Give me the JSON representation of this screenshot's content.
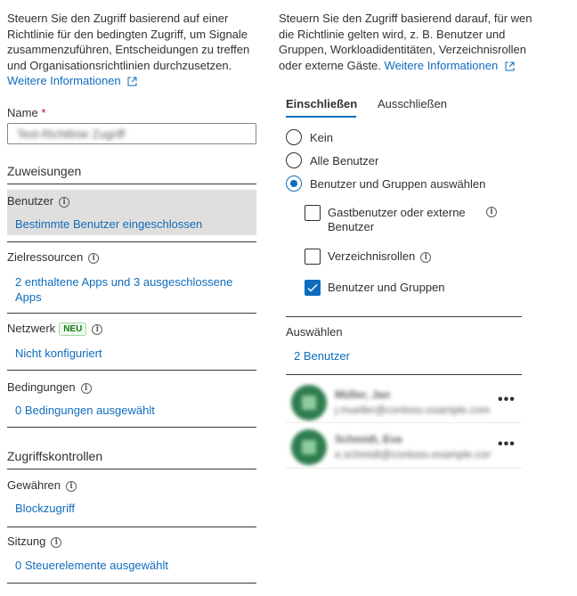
{
  "left": {
    "description": "Steuern Sie den Zugriff basierend auf einer Richtlinie für den bedingten Zugriff, um Signale zusammenzuführen, Entscheidungen zu treffen und Organisationsrichtlinien durchzusetzen.",
    "more_info": "Weitere Informationen",
    "name_label": "Name",
    "name_required": "*",
    "name_value": "Test-Richtlinie Zugriff",
    "assignments_heading": "Zuweisungen",
    "users_label": "Benutzer",
    "users_value": "Bestimmte Benutzer eingeschlossen",
    "target_label": "Zielressourcen",
    "target_value": "2 enthaltene Apps und 3 ausgeschlossene Apps",
    "network_label": "Netzwerk",
    "network_badge": "NEU",
    "network_value": "Nicht konfiguriert",
    "conditions_label": "Bedingungen",
    "conditions_value": "0 Bedingungen ausgewählt",
    "access_controls_heading": "Zugriffskontrollen",
    "grant_label": "Gewähren",
    "grant_value": "Blockzugriff",
    "session_label": "Sitzung",
    "session_value": "0 Steuerelemente ausgewählt"
  },
  "right": {
    "description": "Steuern Sie den Zugriff basierend darauf, für wen die Richtlinie gelten wird, z. B. Benutzer und Gruppen, Workloadidentitäten, Verzeichnisrollen oder externe Gäste.",
    "more_info": "Weitere Informationen",
    "tabs": [
      "Einschließen",
      "Ausschließen"
    ],
    "radio_none": "Kein",
    "radio_all": "Alle Benutzer",
    "radio_select": "Benutzer und Gruppen auswählen",
    "cb_guests": "Gastbenutzer oder externe Benutzer",
    "cb_roles": "Verzeichnisrollen",
    "cb_users_groups": "Benutzer und Gruppen",
    "select_label": "Auswählen",
    "select_value": "2 Benutzer",
    "selected_users": [
      {
        "name": "Müller, Jan",
        "email": "j.mueller@contoso.example.com",
        "more": "•••"
      },
      {
        "name": "Schmidt, Eva",
        "email": "e.schmidt@contoso.example.com",
        "more": "•••"
      }
    ]
  },
  "colors": {
    "accent": "#0f6cbd",
    "required": "#c50f1f",
    "badge_green": "#107c10",
    "selected_row_bg": "#e1dfdd"
  }
}
